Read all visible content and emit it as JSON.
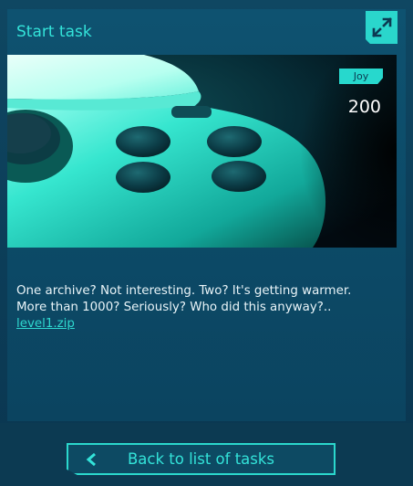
{
  "card": {
    "title": "Start task",
    "expand_icon": "expand-icon",
    "tag": "Joy",
    "points": "200",
    "description_lines": [
      "One archive? Not interesting. Two? It's getting warmer.",
      "More than 1000? Seriously? Who did this anyway?.."
    ],
    "file_link": "level1.zip"
  },
  "footer": {
    "back_label": "Back to list of tasks",
    "back_icon": "chevron-left-icon"
  },
  "colors": {
    "accent": "#2ad6cc",
    "background": "#0b3650",
    "card": "#0e5270"
  }
}
